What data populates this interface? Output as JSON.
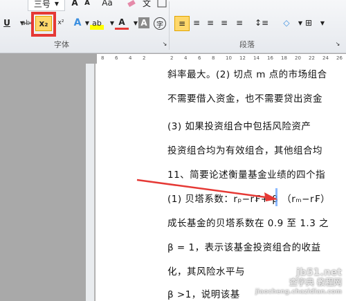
{
  "ribbon": {
    "font_size": "三号",
    "group_font": "字体",
    "group_paragraph": "段落",
    "subscript": "x₂",
    "labels": {
      "underline": "U",
      "strike": "abc",
      "superscript": "x²",
      "font_color": "A",
      "char_shading": "A",
      "enclose": "字",
      "text_effect": "A",
      "highlight": "ab",
      "grow": "A",
      "shrink": "A",
      "change_case": "Aa",
      "phonetic": "文",
      "align_left": "≡",
      "align_center": "≡",
      "align_right": "≡",
      "justify": "≡",
      "distributed": "≡",
      "line_spacing": "↕≡",
      "shading": "◇",
      "borders": "⊞"
    }
  },
  "ruler": [
    "8",
    "6",
    "4",
    "2",
    "",
    "2",
    "4",
    "6",
    "8",
    "10",
    "12",
    "14",
    "16",
    "18",
    "20",
    "22",
    "24",
    "26"
  ],
  "doc": {
    "lines": [
      "斜率最大。(2) 切点 m 点的市场组合",
      "不需要借入资金，也不需要贷出资金",
      "(3) 如果投资组合中包括风险资产",
      "投资组合均为有效组合，其他组合均",
      "11、简要论述衡量基金业绩的四个指",
      "(1) 贝塔系数：rₚ−r₣+ β （rₘ−r₣）",
      "成长基金的贝塔系数在 0.9 至 1.3 之",
      "β = 1，表示该基金投资组合的收益",
      "化，其风险水平与",
      "β >1，说明该基"
    ]
  },
  "watermark": {
    "site": "jb51.net",
    "text": "查字典 教程网",
    "url": "jiaocheng.chazidian.com"
  }
}
